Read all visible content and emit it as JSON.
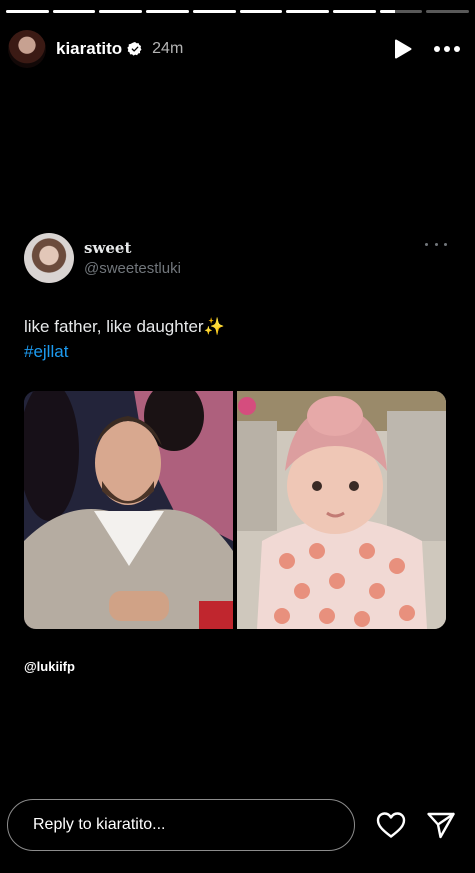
{
  "story": {
    "progress_segments": [
      1,
      1,
      1,
      1,
      1,
      1,
      1,
      1,
      0.35,
      0
    ],
    "user": {
      "username": "kiaratito",
      "verified": true,
      "time_ago": "24m"
    }
  },
  "tweet": {
    "display_name": "sweet",
    "handle": "@sweetestluki",
    "text": "like father, like daughter✨",
    "hashtag": "#ejllat",
    "images": [
      "father-photo",
      "baby-photo"
    ]
  },
  "mention": "@lukiifp",
  "reply": {
    "placeholder": "Reply to kiaratito..."
  },
  "colors": {
    "background": "#000000",
    "hashtag": "#1d9bf0",
    "handle": "#71767b"
  }
}
